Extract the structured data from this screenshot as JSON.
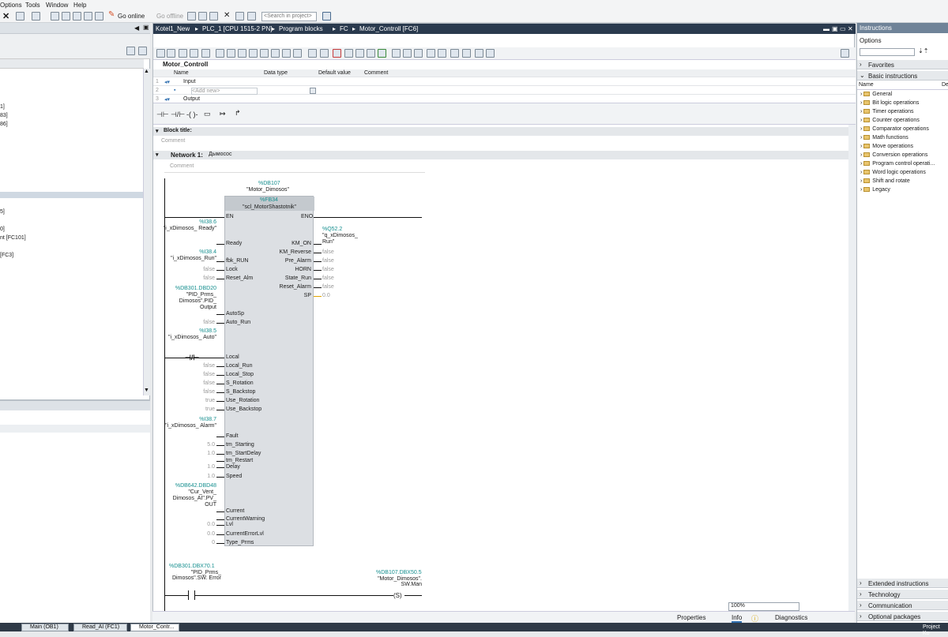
{
  "menu": [
    "Options",
    "Tools",
    "Window",
    "Help"
  ],
  "toolbar": {
    "go_online": "Go online",
    "go_offline": "Go offline",
    "search_placeholder": "<Search in project>"
  },
  "left_tree": [
    "1]",
    "83]",
    "86]",
    "5]",
    "0]",
    "nt [FC101]",
    "[FC3]"
  ],
  "editor": {
    "breadcrumb": [
      "Kotel1_New",
      "PLC_1 [CPU 1515-2 PN]",
      "Program blocks",
      "FC",
      "Motor_Controll [FC6]"
    ],
    "block_name": "Motor_Controll",
    "iface_headers": {
      "name": "Name",
      "type": "Data type",
      "default": "Default value",
      "comment": "Comment"
    },
    "iface_rows": [
      {
        "num": "1",
        "name": "Input"
      },
      {
        "num": "2",
        "name": "<Add new>"
      },
      {
        "num": "3",
        "name": "Output"
      }
    ],
    "block_title_label": "Block title:",
    "comment": "Comment",
    "network_label": "Network 1:",
    "network_title": "Дымосос"
  },
  "fb": {
    "db_addr": "%DB107",
    "db_name": "\"Motor_Dimosos\"",
    "fb_addr": "%FB34",
    "fb_name": "\"scl_MotorShastotnik\"",
    "en": "EN",
    "eno": "ENO",
    "inputs": [
      {
        "pin": "Ready",
        "addr": "%I38.6",
        "tag": "\"i_xDimosos_ Ready\""
      },
      {
        "pin": "fbk_RUN",
        "addr": "%I38.4",
        "tag": "\"i_xDimosos_Run\""
      },
      {
        "pin": "Lock",
        "value": "false"
      },
      {
        "pin": "Reset_Alm",
        "value": "false"
      },
      {
        "pin": "AutoSp",
        "addr": "%DB301.DBD20",
        "tag": "\"PID_Prms_ Dimosos\".PID_ Output"
      },
      {
        "pin": "Auto_Run",
        "value": "false"
      },
      {
        "pin": "Local",
        "addr": "%I38.5",
        "tag": "\"i_xDimosos_ Auto\""
      },
      {
        "pin": "Local_Run",
        "value": "false"
      },
      {
        "pin": "Local_Stop",
        "value": "false"
      },
      {
        "pin": "S_Rotation",
        "value": "false"
      },
      {
        "pin": "S_Backstop",
        "value": "false"
      },
      {
        "pin": "Use_Rotation",
        "value": "true"
      },
      {
        "pin": "Use_Backstop",
        "value": "true"
      },
      {
        "pin": "Fault",
        "addr": "%I38.7",
        "tag": "\"i_xDimosos_ Alarm\""
      },
      {
        "pin": "tm_Starting",
        "value": "5.0"
      },
      {
        "pin": "tm_StartDelay",
        "value": "1.0"
      },
      {
        "pin": "tm_Restart"
      },
      {
        "pin": "Delay",
        "value": "1.0"
      },
      {
        "pin": "Speed",
        "value": "1.0"
      },
      {
        "pin": "Current",
        "addr": "%DB642.DBD48",
        "tag": "\"Cur_Vent_ Dimosos_AI\".PV_ OUT"
      },
      {
        "pin": "CurrentWarning"
      },
      {
        "pin": "Lvl",
        "value": "0.0"
      },
      {
        "pin": "CurrentErrorLvl",
        "value": "0.0"
      },
      {
        "pin": "Type_Prms",
        "value": "0"
      }
    ],
    "outputs": [
      {
        "pin": "KM_ON",
        "addr": "%Q52.2",
        "tag": "\"q_xDimosos_ Run\""
      },
      {
        "pin": "KM_Reverse",
        "value": "false"
      },
      {
        "pin": "Pre_Alarm",
        "value": "false"
      },
      {
        "pin": "HORN",
        "value": "false"
      },
      {
        "pin": "State_Run",
        "value": "false"
      },
      {
        "pin": "Reset_Alarm",
        "value": "false"
      },
      {
        "pin": "SP",
        "value": "0.0"
      }
    ]
  },
  "bottom_rung": {
    "left_addr": "%DB301.DBX70.1",
    "left_tag": "\"PID_Prms_ Dimosos\".SW. Error",
    "right_addr": "%DB107.DBX50.5",
    "right_tag": "\"Motor_Dimosos\". SW.Man",
    "coil": "S"
  },
  "statusbar": {
    "zoom": "100%",
    "properties": "Properties",
    "info": "Info",
    "diagnostics": "Diagnostics"
  },
  "right": {
    "title": "Instructions",
    "options": "Options",
    "favorites": "Favorites",
    "basic": "Basic instructions",
    "col_name": "Name",
    "col_desc": "De",
    "items": [
      "General",
      "Bit logic operations",
      "Timer operations",
      "Counter operations",
      "Comparator operations",
      "Math functions",
      "Move operations",
      "Conversion operations",
      "Program control operati...",
      "Word logic operations",
      "Shift and rotate",
      "Legacy"
    ],
    "sections": [
      "Extended instructions",
      "Technology",
      "Communication",
      "Optional packages"
    ]
  },
  "taskbar": [
    "Main (OB1)",
    "Read_AI (FC1)",
    "Motor_Contr...",
    "Project Ko"
  ]
}
